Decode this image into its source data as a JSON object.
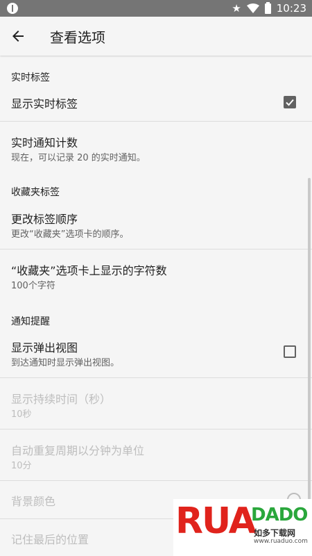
{
  "status_bar": {
    "time": "10:23",
    "left_icon": "alert-icon",
    "right_icons": [
      "star-icon",
      "wifi-icon",
      "battery-icon"
    ]
  },
  "appbar": {
    "back_icon": "arrow-left-icon",
    "title": "查看选项"
  },
  "sections": {
    "realtime": {
      "header": "实时标签",
      "show_label": "显示实时标签",
      "show_checked": true,
      "count_title": "实时通知计数",
      "count_summary": "现在，可以记录 20 的实时通知。"
    },
    "favorites": {
      "header": "收藏夹标签",
      "order_title": "更改标签顺序",
      "order_summary": "更改“收藏夹”选项卡的顺序。",
      "chars_title": "“收藏夹”选项卡上显示的字符数",
      "chars_summary": "100个字符"
    },
    "notify": {
      "header": "通知提醒",
      "popup_title": "显示弹出视图",
      "popup_summary": "到达通知时显示弹出视图。",
      "popup_checked": false,
      "duration_title": "显示持续时间（秒）",
      "duration_summary": "10秒",
      "repeat_title": "自动重复周期以分钟为单位",
      "repeat_summary": "10分",
      "bg_color_title": "背景颜色",
      "remember_pos_title": "记住最后的位置"
    }
  },
  "watermark": {
    "big": "RUA",
    "brand_green": "DADO",
    "cn": "如多下载网",
    "url": "www.ruaduo.com"
  },
  "colors": {
    "background": "#f5f5f5",
    "status_bar": "#757575",
    "text_primary": "#212121",
    "text_secondary": "#616161",
    "text_disabled": "#bdbdbd",
    "divider": "#dcdcdc"
  }
}
